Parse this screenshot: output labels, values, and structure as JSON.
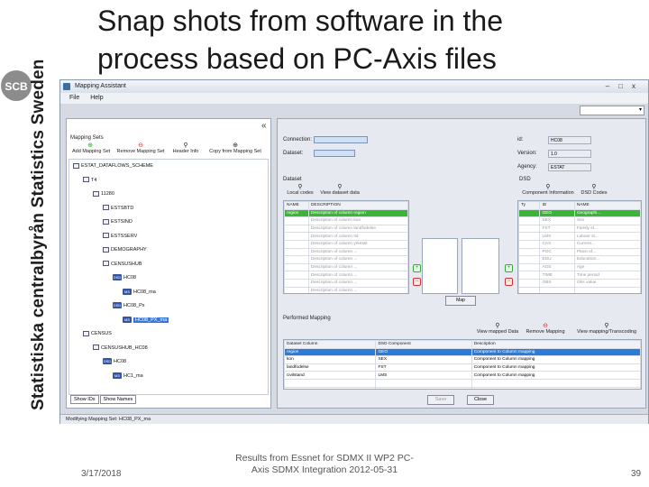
{
  "slide": {
    "title_line1": "Snap shots from software in the",
    "title_line2": "process based on PC-Axis files",
    "logo_text": "SCB",
    "side_text": "Statistiska centralbyrån   Statistics Sweden",
    "footer_date": "3/17/2018",
    "footer_center_line1": "Results from Essnet for SDMX II WP2 PC-",
    "footer_center_line2": "Axis SDMX Integration 2012-05-31",
    "footer_page": "39"
  },
  "window": {
    "title": "Mapping Assistant",
    "menu": [
      "File",
      "Help"
    ],
    "close_glyph": "x",
    "collapse_glyph": "«",
    "status": "Modifying Mapping Set: HC08_PX_ma"
  },
  "mapping_sets": {
    "header": "Mapping Sets",
    "toolbar": [
      "Add Mapping Set",
      "Remove Mapping Set",
      "Header Info",
      "Copy from Mapping Set"
    ],
    "tree": [
      {
        "label": "ESTAT_DATAFLOWS_SCHEME",
        "depth": 0,
        "kind": "box"
      },
      {
        "label": "T4",
        "depth": 1,
        "kind": "box"
      },
      {
        "label": "11280",
        "depth": 2,
        "kind": "box"
      },
      {
        "label": "ESTSBTD",
        "depth": 3,
        "kind": "box"
      },
      {
        "label": "ESTSIND",
        "depth": 3,
        "kind": "box"
      },
      {
        "label": "ESTSSERV",
        "depth": 3,
        "kind": "box"
      },
      {
        "label": "DEMOGRAPHY",
        "depth": 3,
        "kind": "box"
      },
      {
        "label": "CENSUSHUB",
        "depth": 3,
        "kind": "box"
      },
      {
        "label": "HC08",
        "depth": 4,
        "kind": "dsd"
      },
      {
        "label": "HC08_ma",
        "depth": 5,
        "kind": "ms"
      },
      {
        "label": "HC08_Px",
        "depth": 4,
        "kind": "dsd"
      },
      {
        "label": "HC08_PX_ma",
        "depth": 5,
        "kind": "ms",
        "selected": true
      },
      {
        "label": "CENSUS",
        "depth": 1,
        "kind": "box"
      },
      {
        "label": "CENSUSHUB_HC08",
        "depth": 2,
        "kind": "box"
      },
      {
        "label": "HC08",
        "depth": 3,
        "kind": "dsd"
      },
      {
        "label": "HC1_ma",
        "depth": 4,
        "kind": "ms"
      }
    ],
    "tabs": [
      "Show IDs",
      "Show Names"
    ]
  },
  "connection": {
    "connection_label": "Connection:",
    "connection_value": "",
    "dataset_label": "Dataset:",
    "dataset_value": "",
    "id_label": "id:",
    "id_value": "HC08",
    "version_label": "Version:",
    "version_value": "1.0",
    "agency_label": "Agency:",
    "agency_value": "ESTAT"
  },
  "dataset_panel": {
    "header": "Dataset",
    "toolbar": [
      "Local codes",
      "View dataset data"
    ],
    "columns": [
      "NAME",
      "DESCRIPTION"
    ],
    "rows": [
      [
        "region",
        "Description of column region"
      ],
      [
        "",
        "Description of column kon"
      ],
      [
        "",
        "Description of column landfodelse"
      ],
      [
        "",
        "Description of column tid"
      ],
      [
        "",
        "Description of column yrkesst"
      ],
      [
        "",
        "Description of column ..."
      ],
      [
        "",
        "Description of column ..."
      ],
      [
        "",
        "Description of column ..."
      ],
      [
        "",
        "Description of column ..."
      ],
      [
        "",
        "Description of column ..."
      ],
      [
        "",
        "Description of column ..."
      ]
    ]
  },
  "dsd_panel": {
    "header": "DSD",
    "toolbar": [
      "Component Information",
      "DSD Codes"
    ],
    "columns": [
      "Ty",
      "ID",
      "NAME"
    ],
    "rows": [
      [
        "",
        "GEO",
        "Geographi..."
      ],
      [
        "",
        "SEX",
        "Sex"
      ],
      [
        "",
        "FST",
        "Family st..."
      ],
      [
        "",
        "LMS",
        "Labour st..."
      ],
      [
        "",
        "CAS",
        "Current..."
      ],
      [
        "",
        "POC",
        "Place of..."
      ],
      [
        "",
        "EDU",
        "Education..."
      ],
      [
        "",
        "AGE",
        "Age"
      ],
      [
        "",
        "TIME",
        "Time period"
      ],
      [
        "",
        "OBS",
        "Obs value"
      ],
      [
        "",
        "",
        ""
      ]
    ]
  },
  "map_button": "Map",
  "performed_mapping": {
    "header": "Performed Mapping",
    "toolbar": [
      "View mapped Data",
      "Remove Mapping",
      "View mapping/Transcoding"
    ],
    "columns": [
      "Dataset Column",
      "DSD Component",
      "Description"
    ],
    "rows": [
      [
        "region",
        "GEO",
        "Component to Column mapping"
      ],
      [
        "kon",
        "SEX",
        "Component to Column mapping"
      ],
      [
        "landfodelse",
        "FST",
        "Component to Column mapping"
      ],
      [
        "civilstand",
        "LMS",
        "Component to Column mapping"
      ],
      [
        "",
        "",
        ""
      ],
      [
        "",
        "",
        ""
      ]
    ],
    "save_label": "Save",
    "close_label": "Close"
  },
  "colors": {
    "highlight_green": "#3bb536",
    "highlight_blue": "#2b7bd8",
    "window_bg": "#d6dbe3"
  }
}
